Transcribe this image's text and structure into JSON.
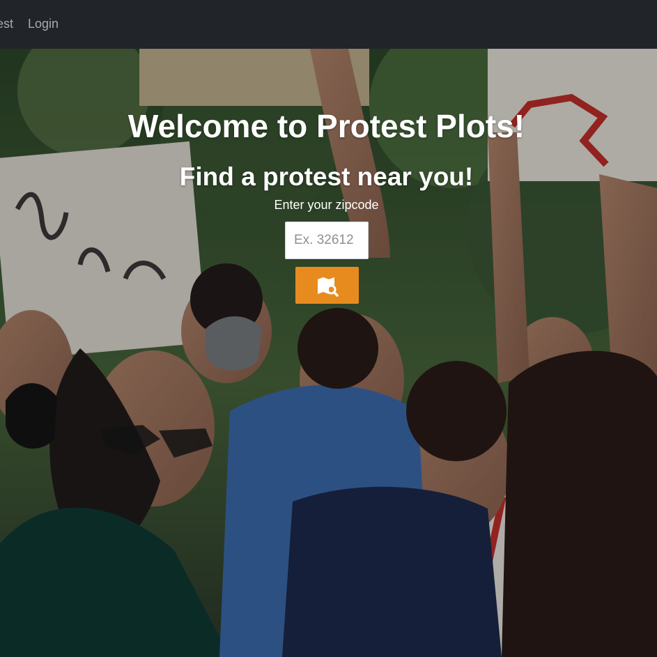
{
  "nav": {
    "items": [
      {
        "label": "Protests"
      },
      {
        "label": "Login"
      }
    ]
  },
  "hero": {
    "title": "Welcome to Protest Plots!",
    "subtitle": "Find a protest near you!",
    "zip_label": "Enter your zipcode",
    "zip_placeholder": "Ex. 32612",
    "zip_value": "",
    "search_button_icon": "map-search-icon"
  },
  "colors": {
    "navbar_bg": "#212529",
    "nav_text": "rgba(255,255,255,0.6)",
    "accent": "#e88b1f",
    "hero_text": "#ffffff"
  }
}
